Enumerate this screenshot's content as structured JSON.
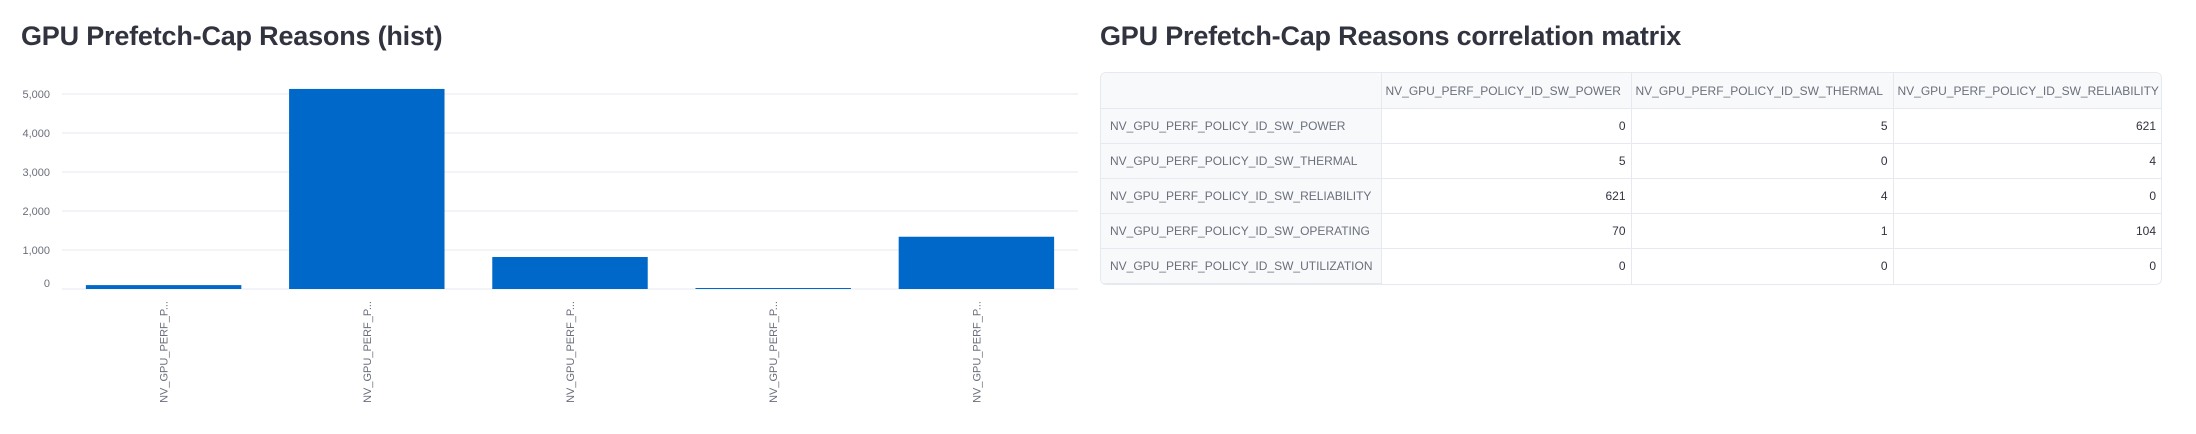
{
  "histogram": {
    "title": "GPU Prefetch-Cap Reasons (hist)"
  },
  "chart_data": {
    "type": "bar",
    "categories": [
      "NV_GPU_PERF_P...",
      "NV_GPU_PERF_P...",
      "NV_GPU_PERF_P...",
      "NV_GPU_PERF_P...",
      "NV_GPU_PERF_P..."
    ],
    "values": [
      100,
      5130,
      820,
      5,
      1340
    ],
    "ylim": [
      0,
      5000
    ],
    "yticks": [
      0,
      1000,
      2000,
      3000,
      4000,
      5000
    ],
    "ytick_labels": [
      "0",
      "1,000",
      "2,000",
      "3,000",
      "4,000",
      "5,000"
    ],
    "bar_color": "#0068c9",
    "grid": true,
    "legend": "none"
  },
  "matrix": {
    "title": "GPU Prefetch-Cap Reasons correlation matrix",
    "columns": [
      "",
      "NV_GPU_PERF_POLICY_ID_SW_POWER",
      "NV_GPU_PERF_POLICY_ID_SW_THERMAL",
      "NV_GPU_PERF_POLICY_ID_SW_RELIABILITY"
    ],
    "rows": [
      {
        "label": "NV_GPU_PERF_POLICY_ID_SW_POWER",
        "values": [
          "0",
          "5",
          "621"
        ]
      },
      {
        "label": "NV_GPU_PERF_POLICY_ID_SW_THERMAL",
        "values": [
          "5",
          "0",
          "4"
        ]
      },
      {
        "label": "NV_GPU_PERF_POLICY_ID_SW_RELIABILITY",
        "values": [
          "621",
          "4",
          "0"
        ]
      },
      {
        "label": "NV_GPU_PERF_POLICY_ID_SW_OPERATING",
        "values": [
          "70",
          "1",
          "104"
        ]
      },
      {
        "label": "NV_GPU_PERF_POLICY_ID_SW_UTILIZATION",
        "values": [
          "0",
          "0",
          "0"
        ]
      }
    ]
  },
  "colors": {
    "text": "#31333f",
    "muted": "#6b6f7b",
    "grid": "#e6e9ef",
    "header_bg": "#f8f9fb",
    "bar": "#0068c9"
  }
}
